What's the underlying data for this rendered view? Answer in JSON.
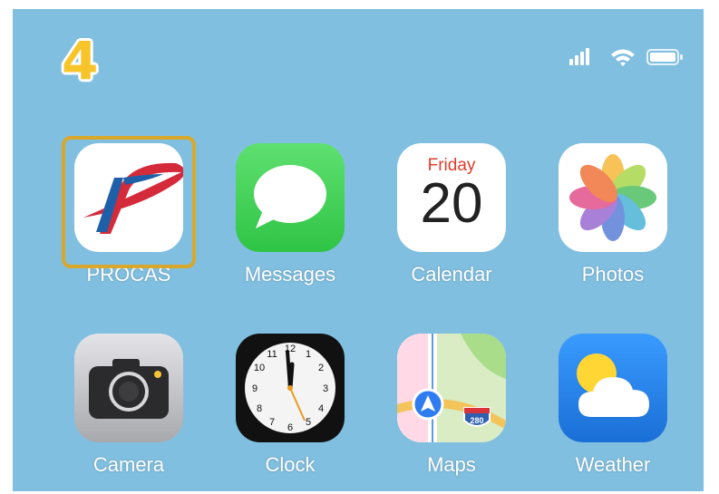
{
  "step_number": "4",
  "status_bar": {
    "signal_icon": "cellular-signal-icon",
    "wifi_icon": "wifi-icon",
    "battery_icon": "battery-icon"
  },
  "apps": [
    {
      "label": "PROCAS",
      "icon": "procas-app-icon",
      "highlighted": true
    },
    {
      "label": "Messages",
      "icon": "messages-app-icon"
    },
    {
      "label": "Calendar",
      "icon": "calendar-app-icon",
      "calendar_day": "Friday",
      "calendar_date": "20"
    },
    {
      "label": "Photos",
      "icon": "photos-app-icon"
    },
    {
      "label": "Camera",
      "icon": "camera-app-icon"
    },
    {
      "label": "Clock",
      "icon": "clock-app-icon"
    },
    {
      "label": "Maps",
      "icon": "maps-app-icon",
      "road_sign": "280"
    },
    {
      "label": "Weather",
      "icon": "weather-app-icon"
    }
  ],
  "colors": {
    "wallpaper": "#80bfe0",
    "highlight_border": "#d9a82b",
    "step_number": "#f7c52a",
    "procas_red": "#d42a3a",
    "procas_blue": "#1f5fa8",
    "messages_green": "#3fd155",
    "weather_blue": "#2f8ff0"
  }
}
